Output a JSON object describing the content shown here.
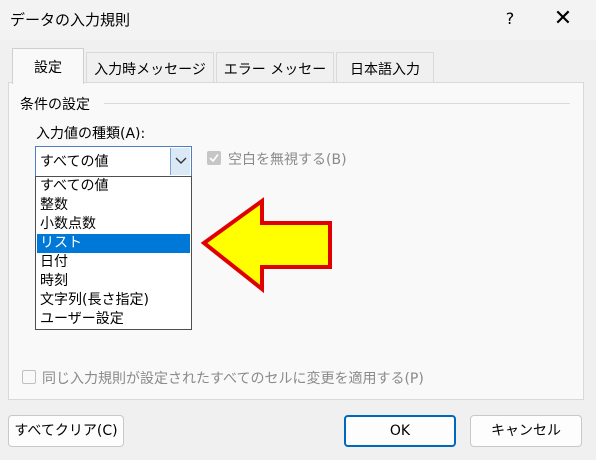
{
  "window": {
    "title": "データの入力規則",
    "help": "?",
    "close": "✕"
  },
  "tabs": [
    {
      "label": "設定"
    },
    {
      "label": "入力時メッセージ"
    },
    {
      "label": "エラー メッセージ"
    },
    {
      "label": "日本語入力"
    }
  ],
  "conditions": {
    "group_label": "条件の設定",
    "type_label": "入力値の種類(A):",
    "selected_value": "すべての値",
    "ignore_blank_label": "空白を無視する(B)",
    "ignore_blank_checked": true,
    "options": [
      "すべての値",
      "整数",
      "小数点数",
      "リスト",
      "日付",
      "時刻",
      "文字列(長さ指定)",
      "ユーザー設定"
    ],
    "highlighted_option": "リスト"
  },
  "apply_all": {
    "label": "同じ入力規則が設定されたすべてのセルに変更を適用する(P)",
    "checked": false
  },
  "buttons": {
    "clear_all": "すべてクリア(C)",
    "ok": "OK",
    "cancel": "キャンセル"
  },
  "colors": {
    "selection": "#0078d7",
    "annotation_arrow_fill": "#ffff00",
    "annotation_arrow_stroke": "#e00000"
  }
}
